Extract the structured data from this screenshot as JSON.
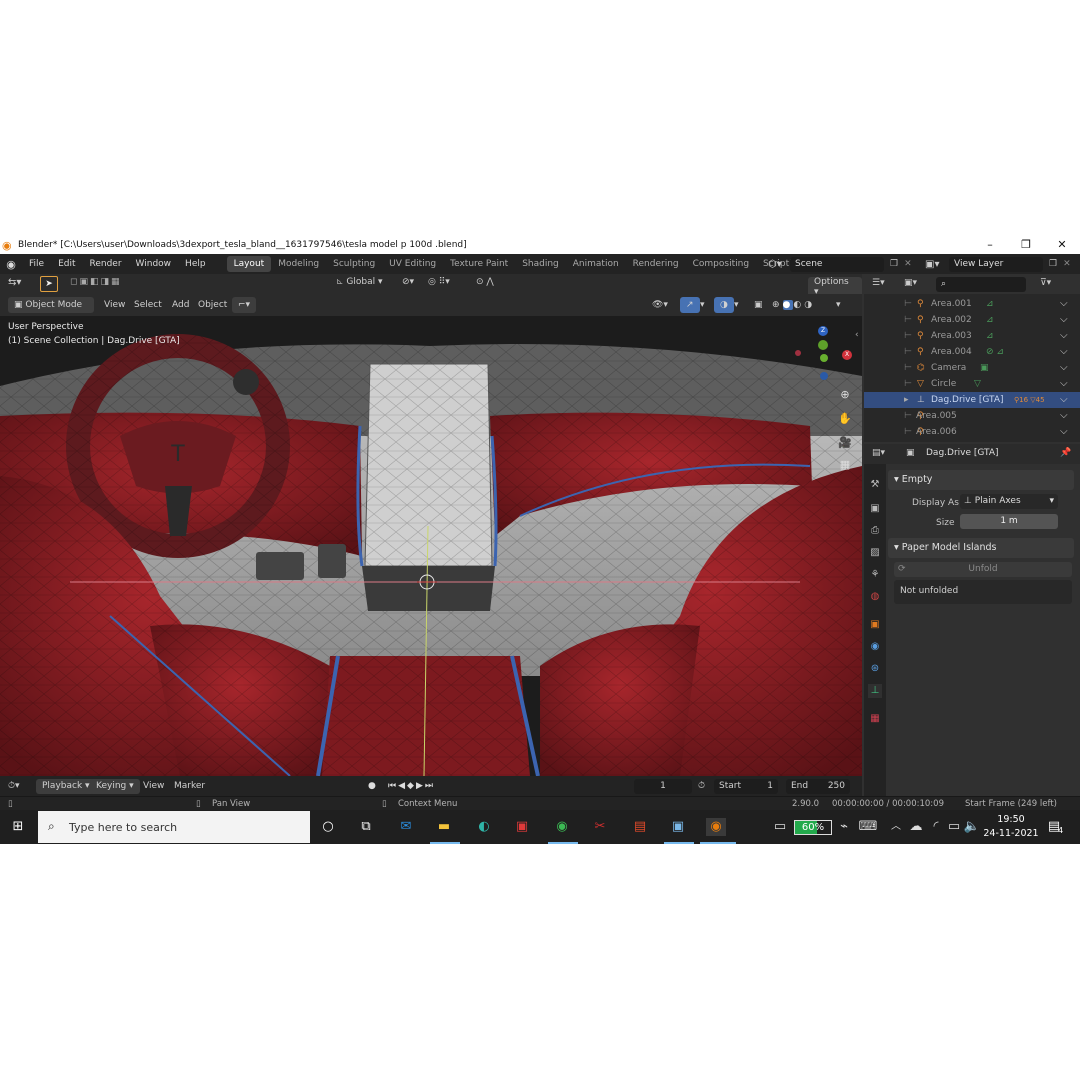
{
  "window": {
    "title": "Blender* [C:\\Users\\user\\Downloads\\3dexport_tesla_bland__1631797546\\tesla model p 100d .blend]"
  },
  "menu": [
    "File",
    "Edit",
    "Render",
    "Window",
    "Help"
  ],
  "workspaces": [
    "Layout",
    "Modeling",
    "Sculpting",
    "UV Editing",
    "Texture Paint",
    "Shading",
    "Animation",
    "Rendering",
    "Compositing",
    "Scripting"
  ],
  "active_workspace": "Layout",
  "scene": {
    "label": "Scene"
  },
  "view_layer": {
    "label": "View Layer"
  },
  "viewport_header": {
    "mode": "Object Mode",
    "view": "View",
    "select": "Select",
    "add": "Add",
    "object": "Object",
    "orientation": "Global",
    "options": "Options"
  },
  "viewport": {
    "perspective": "User Perspective",
    "collection": "(1) Scene Collection | Dag.Drive [GTA]"
  },
  "outliner": {
    "items": [
      {
        "name": "Area.001",
        "selected": false
      },
      {
        "name": "Area.002",
        "selected": false
      },
      {
        "name": "Area.003",
        "selected": false
      },
      {
        "name": "Area.004",
        "selected": false
      },
      {
        "name": "Camera",
        "selected": false
      },
      {
        "name": "Circle",
        "selected": false
      },
      {
        "name": "Dag.Drive [GTA]",
        "selected": true,
        "badge_a": "16",
        "badge_b": "45"
      },
      {
        "name": "Area.005",
        "selected": false
      },
      {
        "name": "Area.006",
        "selected": false
      }
    ]
  },
  "properties": {
    "object_name": "Dag.Drive [GTA]",
    "empty_panel": "Empty",
    "display_as_label": "Display As",
    "display_as_value": "Plain Axes",
    "size_label": "Size",
    "size_value": "1 m",
    "paper_panel": "Paper Model Islands",
    "unfold_button": "Unfold",
    "not_unfolded": "Not unfolded"
  },
  "timeline": {
    "playback": "Playback",
    "keying": "Keying",
    "view": "View",
    "marker": "Marker",
    "current_frame": "1",
    "start_label": "Start",
    "start_value": "1",
    "end_label": "End",
    "end_value": "250"
  },
  "statusbar": {
    "pan_view": "Pan View",
    "context_menu": "Context Menu",
    "version": "2.90.0",
    "time": "00:00:00:00 / 00:00:10:09",
    "start_frame": "Start Frame (249 left)"
  },
  "taskbar": {
    "search_placeholder": "Type here to search",
    "battery": "60%",
    "clock_time": "19:50",
    "clock_date": "24-11-2021",
    "notifications": "4"
  },
  "colors": {
    "seat_red": "#8e1f24",
    "selection_blue": "#334d80",
    "accent_orange": "#e87d0d"
  }
}
